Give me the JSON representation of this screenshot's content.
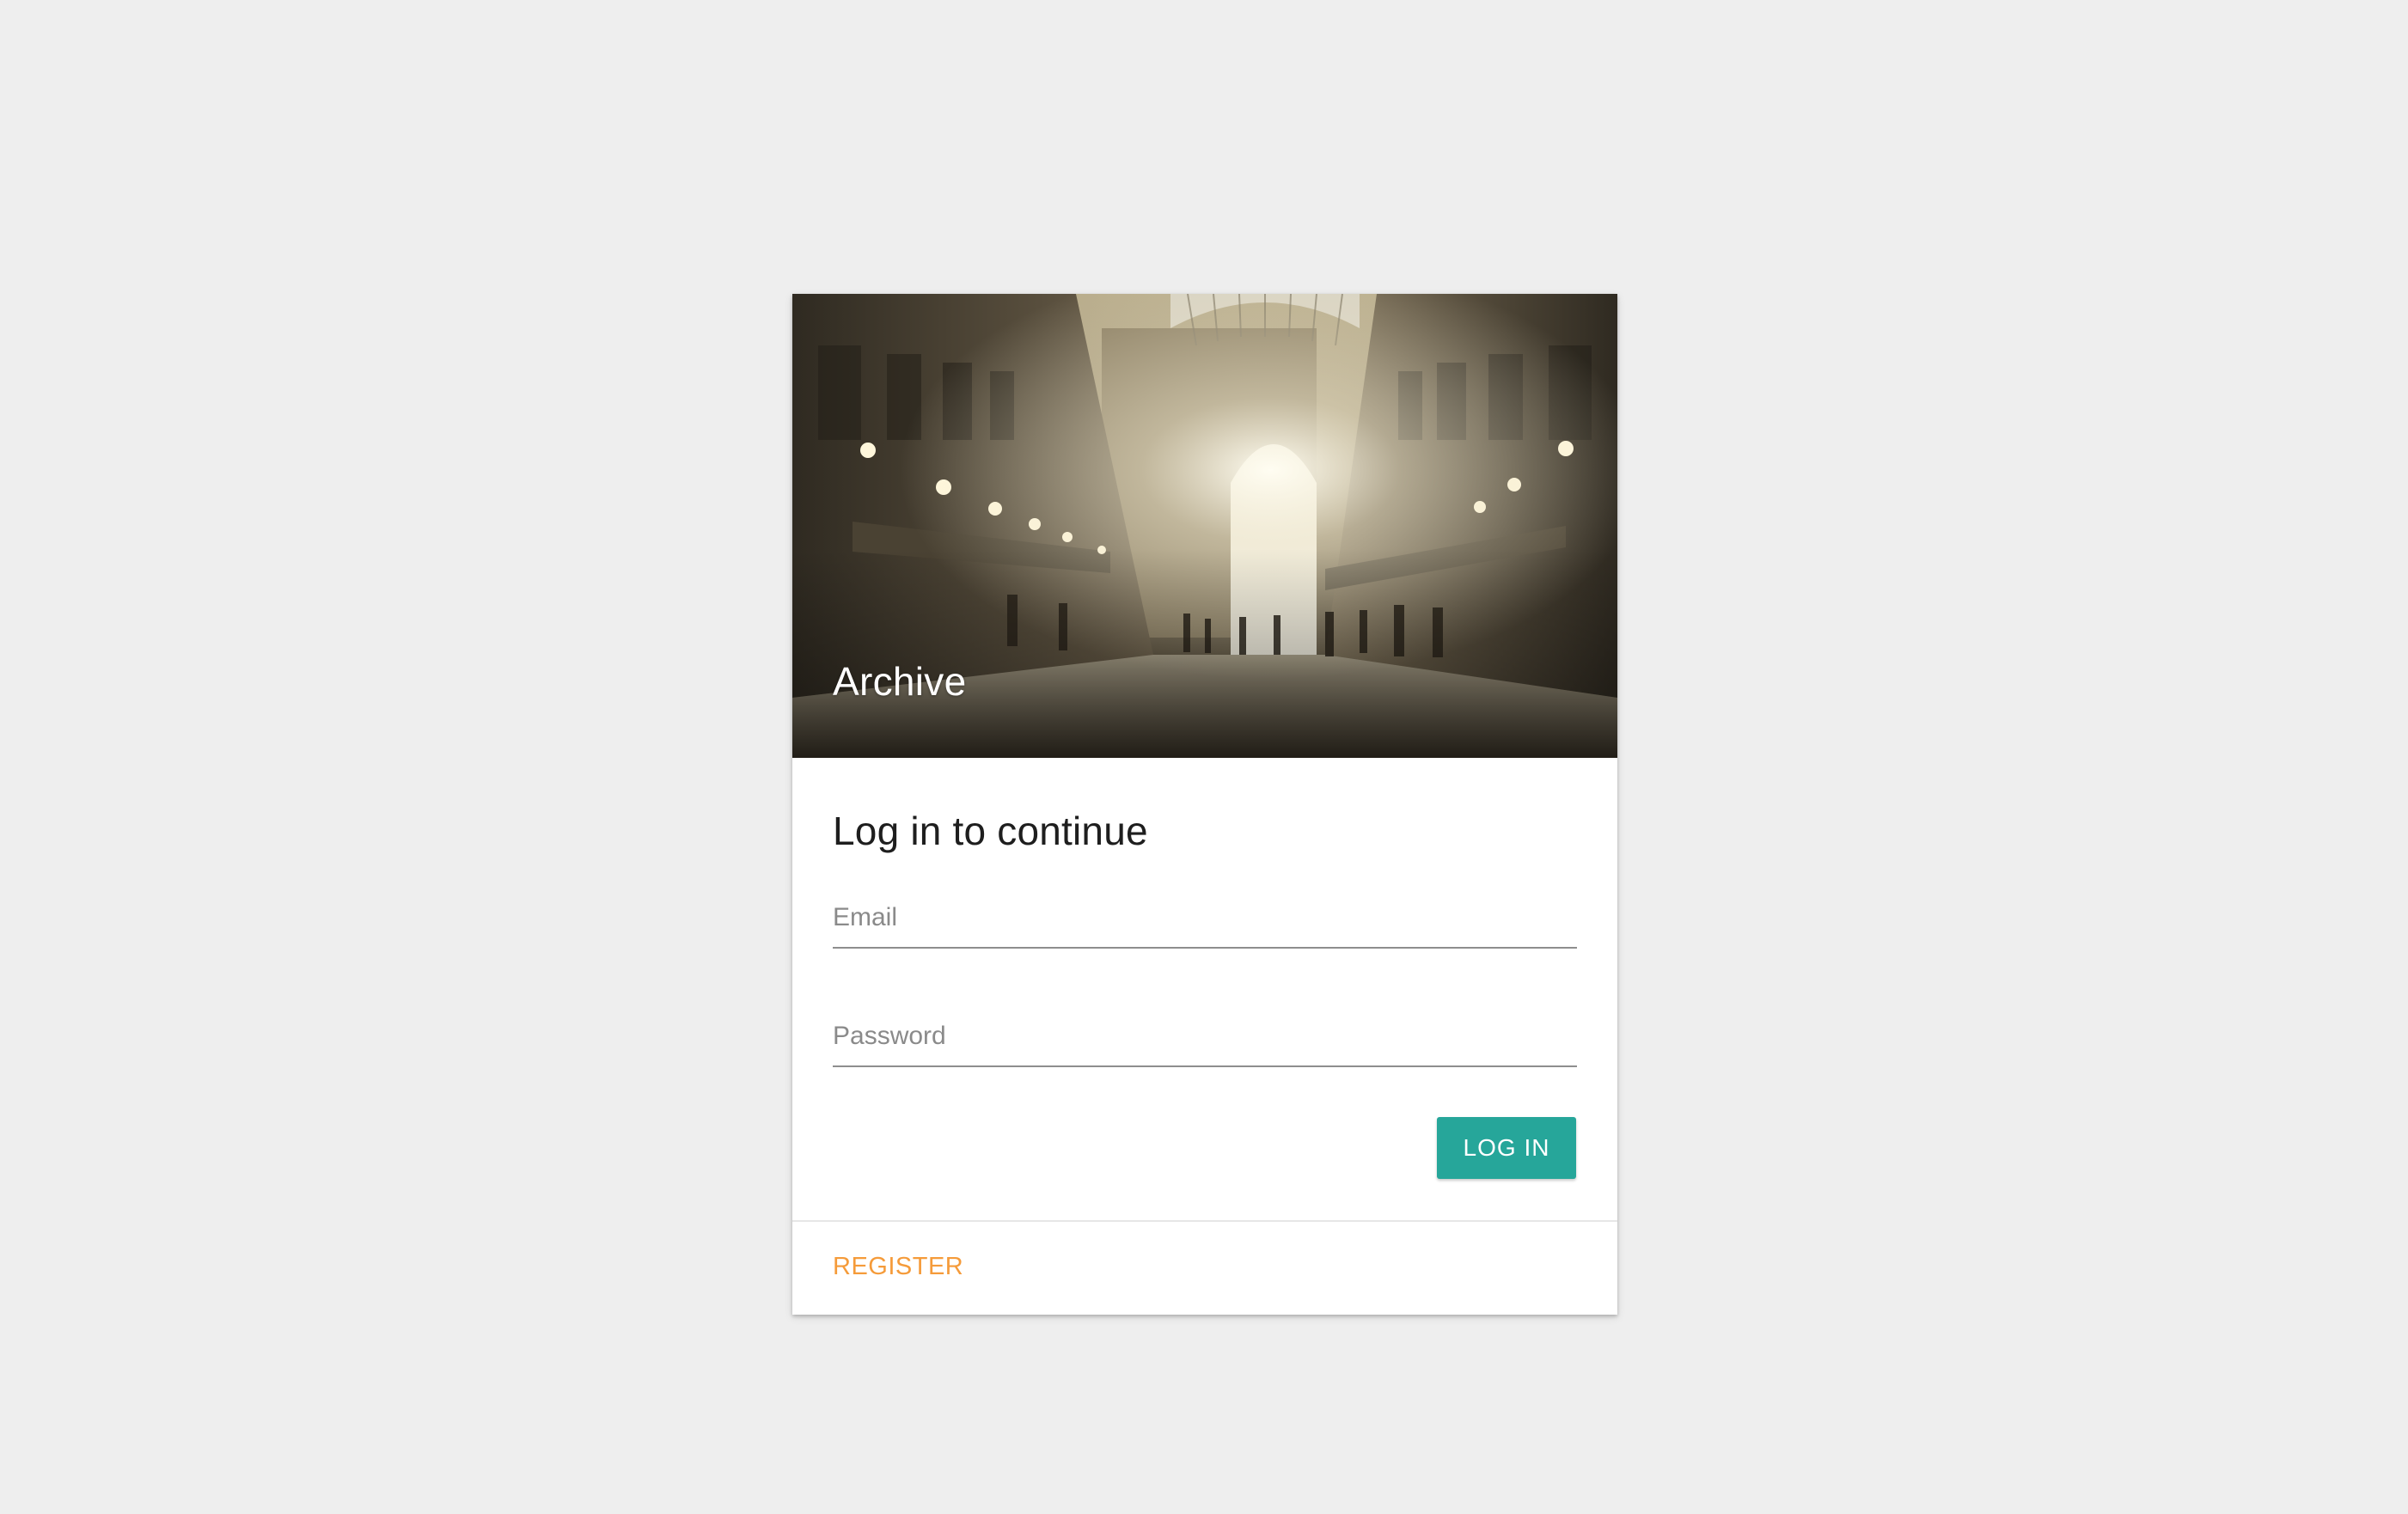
{
  "hero": {
    "title": "Archive"
  },
  "login_form": {
    "heading": "Log in to continue",
    "email_placeholder": "Email",
    "password_placeholder": "Password",
    "login_label": "LOG IN"
  },
  "footer": {
    "register_label": "REGISTER"
  },
  "colors": {
    "page_background": "#eeeeee",
    "primary_button": "#26a69a",
    "register_link": "#f59b3a"
  }
}
